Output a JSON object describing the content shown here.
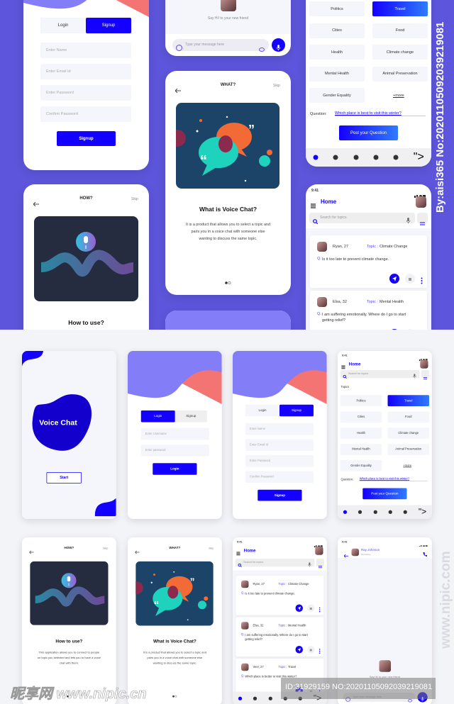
{
  "colors": {
    "brand": "#1400ff",
    "top_background": "#5d56dc",
    "bottom_background": "#f3f4f8",
    "wave": "#837df8",
    "wave_accent": "#f47373"
  },
  "splash": {
    "title": "Voice Chat",
    "start": "Start"
  },
  "login": {
    "tab_login": "Login",
    "tab_signup": "Signup",
    "username": "Enter Username",
    "password": "Enter password",
    "submit": "Login"
  },
  "signup": {
    "tab_login": "Login",
    "tab_signup": "Signup",
    "fields": [
      "Enter Name",
      "Enter Email Id",
      "Enter Password",
      "Confirm Password"
    ],
    "submit": "Signup"
  },
  "how": {
    "header": "HOW?",
    "skip": "Skip",
    "title": "How to use?",
    "body": "This application allows you to connect to people on topic you selected and lets you to have a voice chat with them."
  },
  "what": {
    "header": "WHAT?",
    "skip": "Skip",
    "title": "What is Voice Chat?",
    "body": "It is a product that allows you to select a topic and pairs you in a voice chat with someone else wanting to discuss the same topic."
  },
  "status": {
    "time": "9:41"
  },
  "home": {
    "title": "Home",
    "search_placeholder": "Search for topics"
  },
  "topics": {
    "label": "Topics",
    "items": [
      "Politics",
      "Travel",
      "Cities",
      "Food",
      "Health",
      "Climate change",
      "Mental Health",
      "Animal Preservation",
      "Gender Equality"
    ],
    "selected": "Travel",
    "more": "+more",
    "question_label": "Question:",
    "question_value": "Which place is best to visit this winter?",
    "post": "Post your Question"
  },
  "feed": {
    "topic_label": "Topic :",
    "q_label": "Q.",
    "posts": [
      {
        "name": "Ryan, 27",
        "topic": "Climate Change",
        "question": "Is it too late to prevent climate change."
      },
      {
        "name": "Elsa, 32",
        "topic": "Mental Health",
        "question": "I am suffering emotionally. Where do I go to start getting relief?"
      },
      {
        "name": "Veer, 27",
        "topic": "Travel",
        "question": "Which place is better to visit this winter?"
      }
    ]
  },
  "chat": {
    "name": "Ray Johnson",
    "status": "Not Active",
    "greeting": "Say Hi! to your new friend",
    "placeholder": "Type your message here"
  },
  "watermarks": {
    "side_top": "By:aisi365 No:20201105092039219081",
    "side_bottom": "www.nipic.com",
    "logo": "昵享网 www.nipic.cn",
    "id": "ID:31929159 NO:20201105092039219081"
  }
}
